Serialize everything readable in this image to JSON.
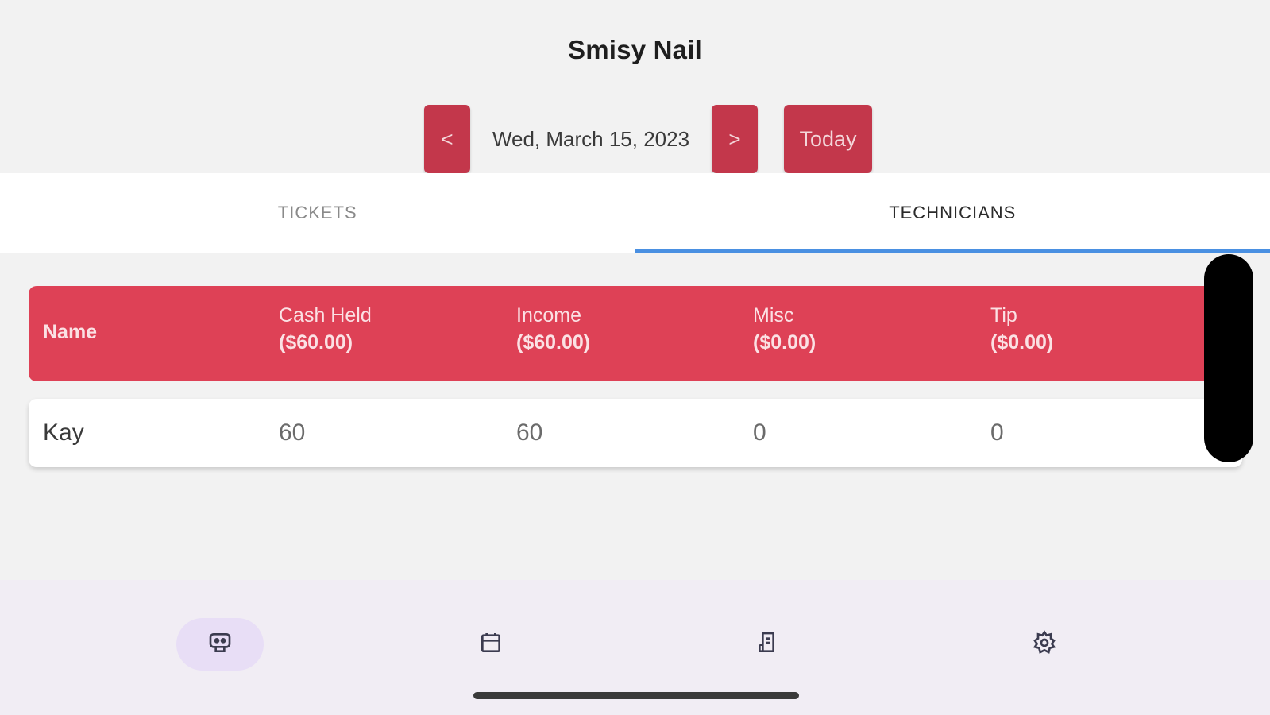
{
  "app": {
    "title": "Smisy Nail"
  },
  "date_nav": {
    "prev_label": "<",
    "date": "Wed, March 15, 2023",
    "next_label": ">",
    "today_label": "Today"
  },
  "tabs": [
    {
      "label": "TICKETS",
      "active": false
    },
    {
      "label": "TECHNICIANS",
      "active": true
    }
  ],
  "table": {
    "columns": [
      {
        "label": "Name",
        "total": ""
      },
      {
        "label": "Cash Held",
        "total": "($60.00)"
      },
      {
        "label": "Income",
        "total": "($60.00)"
      },
      {
        "label": "Misc",
        "total": "($0.00)"
      },
      {
        "label": "Tip",
        "total": "($0.00)"
      }
    ],
    "rows": [
      {
        "name": "Kay",
        "cash_held": "60",
        "income": "60",
        "misc": "0",
        "tip": "0"
      }
    ]
  },
  "bottom_nav": [
    {
      "icon": "register-icon",
      "active": true
    },
    {
      "icon": "calendar-icon",
      "active": false
    },
    {
      "icon": "receipt-icon",
      "active": false
    },
    {
      "icon": "gear-icon",
      "active": false
    }
  ],
  "colors": {
    "accent_red": "#c3374b",
    "header_red": "#de4156",
    "tab_indicator": "#4a90e2",
    "nav_active_bg": "#e8def6"
  }
}
